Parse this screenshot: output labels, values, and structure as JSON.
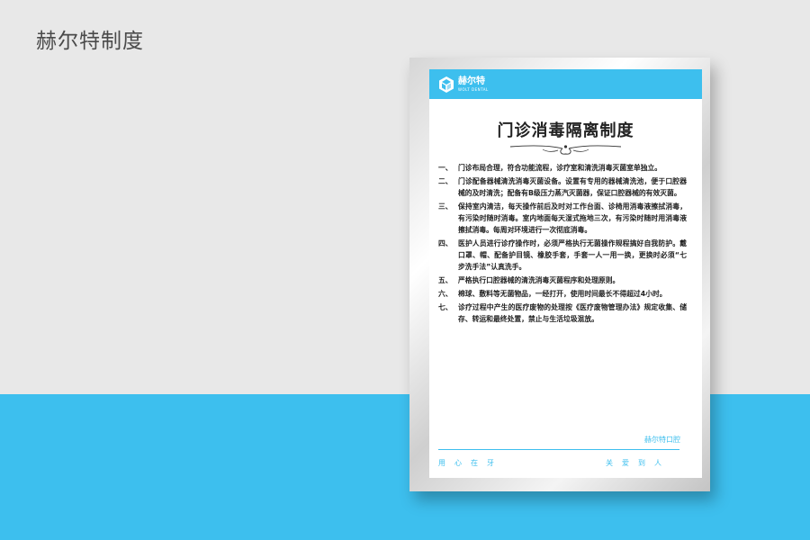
{
  "page": {
    "title": "赫尔特制度"
  },
  "colors": {
    "accent": "#3dbfee",
    "background_top": "#e8e8e8",
    "text": "#222222"
  },
  "poster": {
    "logo": {
      "name": "赫尔特",
      "subtitle": "WOLT DENTAL",
      "icon": "hexagon-cube-icon"
    },
    "title": "门诊消毒隔离制度",
    "rules": [
      {
        "num": "一、",
        "text": "门诊布局合理，符合功能流程，诊疗室和清洗消毒灭菌室单独立。"
      },
      {
        "num": "二、",
        "text": "门诊配备器械清洗消毒灭菌设备。设置有专用的器械清洗池，便于口腔器械的及时清洗；配备有B级压力蒸汽灭菌器，保证口腔器械的有效灭菌。"
      },
      {
        "num": "三、",
        "text": "保持室内清洁，每天操作前后及时对工作台面、诊椅用消毒液擦拭消毒，有污染时随时消毒。室内地面每天湿式拖地三次，有污染时随时用消毒液擦拭消毒。每周对环境进行一次彻底消毒。"
      },
      {
        "num": "四、",
        "text": "医护人员进行诊疗操作时，必须严格执行无菌操作规程搞好自我防护。戴口罩、帽、配备护目镜、橡胶手套，手套一人一用一换，更换时必须“七步洗手法”认真洗手。"
      },
      {
        "num": "五、",
        "text": "严格执行口腔器械的清洗消毒灭菌程序和处理原则。"
      },
      {
        "num": "六、",
        "text": "棉球、敷料等无菌物品，一经打开，使用时间最长不得超过4小时。"
      },
      {
        "num": "七、",
        "text": "诊疗过程中产生的医疗废物的处理按《医疗废物管理办法》规定收集、储存、转运和最终处置，禁止与生活垃圾混放。"
      }
    ],
    "footer": {
      "org": "赫尔特口腔",
      "slogan_left": "用心在牙",
      "slogan_right": "关爱到人"
    }
  }
}
